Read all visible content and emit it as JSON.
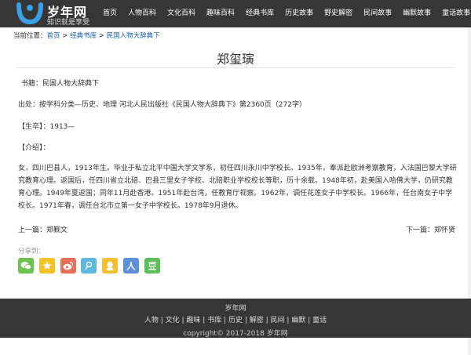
{
  "header": {
    "logo_name": "岁年网",
    "logo_slogan": "知识就是享受",
    "nav": [
      "首页",
      "人物百科",
      "文化百科",
      "趣味百科",
      "经典书库",
      "历史故事",
      "野史解密",
      "民间故事",
      "幽默故事",
      "童话故事"
    ]
  },
  "breadcrumb": {
    "prefix": "当前位置：",
    "items": [
      "首页",
      "经典书库",
      "民国人物大辞典下"
    ],
    "separator": " > "
  },
  "article": {
    "title": "郑玺璌",
    "book": "书籍：民国人物大辞典下",
    "source": "出处：按学科分类—历史、地理 河北人民出版社《民国人物大辞典下》第2360页（272字）",
    "birth": "【生卒】：1913—",
    "intro_label": "【介绍】：",
    "bio": "女，四川巴县人，1913年生。毕业于私立北平中国大学文学系，初任四川永川中学校长。1935年，奉派赴欧洲考察教育，入法国巴黎大学研究教育心理。返国后，任四川省立北碚、巴县三里女子学校、北碚职业学校校长等职，历十余载。1948年初，赴美国入哈佛大学，仍研究教育心理。1949年夏返国；同年11月赴香港。1951年赴台湾，任教育厅视察。1962年，调任花莲女子中学校长。1966年，任台南女子中学校长。1971年春，调任台北市立第一女子中学校长。1978年9月退休。",
    "prev_label": "上一篇：",
    "prev_title": "郑觐文",
    "next_label": "下一篇：",
    "next_title": "郑怀贤"
  },
  "share": {
    "label": "分享到：",
    "buttons": [
      {
        "name": "wechat-icon",
        "color": "#6cc34f"
      },
      {
        "name": "qzone-icon",
        "color": "#f6c325"
      },
      {
        "name": "weibo-icon",
        "color": "#ea6f5a"
      },
      {
        "name": "tencent-weibo-icon",
        "color": "#5fb8de"
      },
      {
        "name": "qq-icon",
        "color": "#f2c035"
      },
      {
        "name": "renren-icon",
        "color": "#5f8fd6"
      },
      {
        "name": "douban-icon",
        "color": "#5cbf5a"
      }
    ]
  },
  "footer": {
    "brand": "岁年网",
    "links": [
      "人物",
      "文化",
      "趣味",
      "书库",
      "历史",
      "解密",
      "民间",
      "幽默",
      "童话"
    ],
    "copyright": "copyright© 2017-2018 岁年网"
  },
  "colors": {
    "header_bg": "#363636",
    "link": "#1a5fa8"
  }
}
